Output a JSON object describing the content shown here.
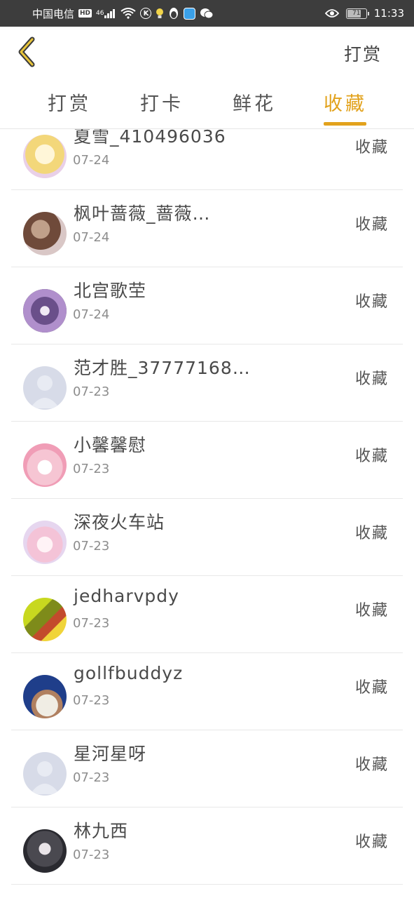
{
  "status_bar": {
    "carrier": "中国电信",
    "hd": "HD",
    "signal": "46",
    "k_icon": "K",
    "battery": "71",
    "time": "11:33"
  },
  "header": {
    "action_label": "打赏"
  },
  "tabs": [
    {
      "label": "打赏",
      "active": false
    },
    {
      "label": "打卡",
      "active": false
    },
    {
      "label": "鲜花",
      "active": false
    },
    {
      "label": "收藏",
      "active": true
    }
  ],
  "accent_color": "#e2a21c",
  "list": [
    {
      "name": "夏雪_410496036",
      "date": "07-24",
      "label": "收藏"
    },
    {
      "name": "枫叶蔷薇_蔷薇…",
      "date": "07-24",
      "label": "收藏"
    },
    {
      "name": "北宫歌茔",
      "date": "07-24",
      "label": "收藏"
    },
    {
      "name": "范才胜_37777168…",
      "date": "07-23",
      "label": "收藏"
    },
    {
      "name": "小馨馨慰",
      "date": "07-23",
      "label": "收藏"
    },
    {
      "name": "深夜火车站",
      "date": "07-23",
      "label": "收藏"
    },
    {
      "name": "jedharvpdy",
      "date": "07-23",
      "label": "收藏"
    },
    {
      "name": "gollfbuddyz",
      "date": "07-23",
      "label": "收藏"
    },
    {
      "name": "星河星呀",
      "date": "07-23",
      "label": "收藏"
    },
    {
      "name": "林九西",
      "date": "07-23",
      "label": "收藏"
    }
  ]
}
